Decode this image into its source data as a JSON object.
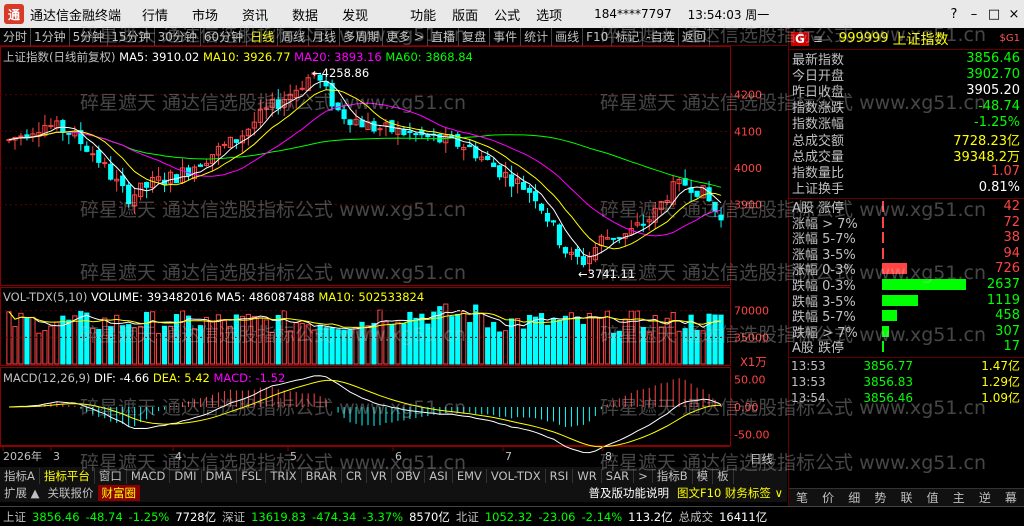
{
  "titlebar": {
    "app_title": "通达信金融终端",
    "menus": [
      "行情",
      "市场",
      "资讯",
      "数据",
      "发现"
    ],
    "menus2": [
      "功能",
      "版面",
      "公式",
      "选项"
    ],
    "account": "184****7797",
    "clock": "13:54:03 周一",
    "win": [
      "?",
      "–",
      "□",
      "×"
    ]
  },
  "toolbar": {
    "items": [
      "分时",
      "1分钟",
      "5分钟",
      "15分钟",
      "30分钟",
      "60分钟",
      "日线",
      "周线",
      "月线",
      "多周期",
      "更多 >",
      "直播",
      "复盘",
      "事件",
      "统计",
      "画线",
      "F10",
      "标记",
      "-自选",
      "返回"
    ],
    "active": "日线"
  },
  "main": {
    "title": "上证指数(日线前复权)",
    "ma5": "MA5: 3910.02",
    "ma10": "MA10: 3926.77",
    "ma20": "MA20: 3893.16",
    "ma60": "MA60: 3868.84",
    "high_label": "←4258.86",
    "low_label": "←3741.11",
    "price_ticks": [
      "4200",
      "4100",
      "4000",
      "3900"
    ],
    "vol_title": "VOL-TDX(5,10)",
    "vol_volume": "VOLUME: 393482016",
    "vol_ma5": "MA5: 486087488",
    "vol_ma10": "MA10: 502533824",
    "vol_ticks": [
      "70000",
      "35000"
    ],
    "vol_unit": "X1万",
    "macd_title": "MACD(12,26,9)",
    "macd_dif": "DIF: -4.66",
    "macd_dea": "DEA: 5.42",
    "macd_macd": "MACD: -1.52",
    "macd_ticks": [
      "50.00",
      "0.00",
      "-50.00"
    ],
    "date_labels": [
      "2026年",
      "3",
      "4",
      "5",
      "6",
      "7",
      "8"
    ],
    "period_label": "日线"
  },
  "chart_data": {
    "type": "candlestick",
    "note_scale": "price 3700-4300",
    "price_range": [
      3700,
      4300
    ],
    "high": 4258.86,
    "low": 3741.11
  },
  "tabbar": {
    "items": [
      "指标A",
      "指标平台",
      "窗口",
      "MACD",
      "DMI",
      "DMA",
      "FSL",
      "TRIX",
      "BRAR",
      "CR",
      "VR",
      "OBV",
      "ASI",
      "EMV",
      "VOL-TDX",
      "RSI",
      "WR",
      "SAR",
      ">",
      "指标B",
      "模",
      "板"
    ],
    "active": "指标平台"
  },
  "subtabbar": {
    "items": [
      "扩展 ▲",
      "关联报价",
      "财富圈"
    ],
    "hot": "财富圈",
    "right_text": "普及版功能说明",
    "right_f10": "图文F10 财务标签 ∨"
  },
  "statusbar": {
    "items": [
      {
        "t": "上证",
        "c": "lbl"
      },
      {
        "t": "3856.46",
        "c": "down"
      },
      {
        "t": "-48.74",
        "c": "down"
      },
      {
        "t": "-1.25%",
        "c": "down"
      },
      {
        "t": "7728亿",
        "c": "white"
      },
      {
        "t": "深证",
        "c": "lbl"
      },
      {
        "t": "13619.83",
        "c": "down"
      },
      {
        "t": "-474.34",
        "c": "down"
      },
      {
        "t": "-3.37%",
        "c": "down"
      },
      {
        "t": "8570亿",
        "c": "white"
      },
      {
        "t": "北证",
        "c": "lbl"
      },
      {
        "t": "1052.32",
        "c": "down"
      },
      {
        "t": "-23.06",
        "c": "down"
      },
      {
        "t": "-2.14%",
        "c": "down"
      },
      {
        "t": "113.2亿",
        "c": "white"
      },
      {
        "t": "总成交",
        "c": "lbl"
      },
      {
        "t": "16411亿",
        "c": "white"
      }
    ]
  },
  "rightpanel": {
    "code": "999999",
    "name": "上证指数",
    "tag": "$G1",
    "g_label": "G",
    "menu_icon": "≡",
    "rows": [
      {
        "label": "最新指数",
        "value": "3856.46",
        "cls": "down"
      },
      {
        "label": "今日开盘",
        "value": "3902.70",
        "cls": "down"
      },
      {
        "label": "昨日收盘",
        "value": "3905.20",
        "cls": "white"
      },
      {
        "label": "指数涨跌",
        "value": "-48.74",
        "cls": "down"
      },
      {
        "label": "指数涨幅",
        "value": "-1.25%",
        "cls": "down"
      },
      {
        "label": "总成交额",
        "value": "7728.23亿",
        "cls": "yel"
      },
      {
        "label": "总成交量",
        "value": "39348.2万",
        "cls": "yel"
      },
      {
        "label": "指数量比",
        "value": "1.07",
        "cls": "up"
      },
      {
        "label": "上证换手",
        "value": "0.81%",
        "cls": "white"
      }
    ],
    "breadth": [
      {
        "label": "A股 涨停",
        "value": "42",
        "cls": "up",
        "bar": 0.01
      },
      {
        "label": "涨幅 > 7%",
        "value": "72",
        "cls": "up",
        "bar": 0.015
      },
      {
        "label": "涨幅 5-7%",
        "value": "38",
        "cls": "up",
        "bar": 0.01
      },
      {
        "label": "涨幅 3-5%",
        "value": "94",
        "cls": "up",
        "bar": 0.02
      },
      {
        "label": "涨幅 0-3%",
        "value": "726",
        "cls": "up",
        "bar": 0.3
      },
      {
        "label": "跌幅 0-3%",
        "value": "2637",
        "cls": "down",
        "bar": 1.0
      },
      {
        "label": "跌幅 3-5%",
        "value": "1119",
        "cls": "down",
        "bar": 0.43
      },
      {
        "label": "跌幅 5-7%",
        "value": "458",
        "cls": "down",
        "bar": 0.18
      },
      {
        "label": "跌幅 > 7%",
        "value": "307",
        "cls": "down",
        "bar": 0.08
      },
      {
        "label": "A股 跌停",
        "value": "17",
        "cls": "down",
        "bar": 0.01
      }
    ],
    "ticks": [
      {
        "t": "13:53",
        "p": "3856.77",
        "c": "1.47亿"
      },
      {
        "t": "13:53",
        "p": "3856.83",
        "c": "1.29亿"
      },
      {
        "t": "13:54",
        "p": "3856.46",
        "c": "1.09亿"
      }
    ],
    "foot": [
      "笔",
      "价",
      "细",
      "势",
      "联",
      "值",
      "主",
      "逆",
      "幕"
    ]
  },
  "watermark": "碎星遮天 通达信选股指标公式 www.xg51.cn",
  "colors": {
    "up": "#ff4444",
    "down": "#00ff00",
    "ma5": "#ffffff",
    "ma10": "#ffff00",
    "ma20": "#ff00ff",
    "ma60": "#00ff00",
    "vol_up": "#ff4444",
    "vol_down": "#00ffff"
  }
}
